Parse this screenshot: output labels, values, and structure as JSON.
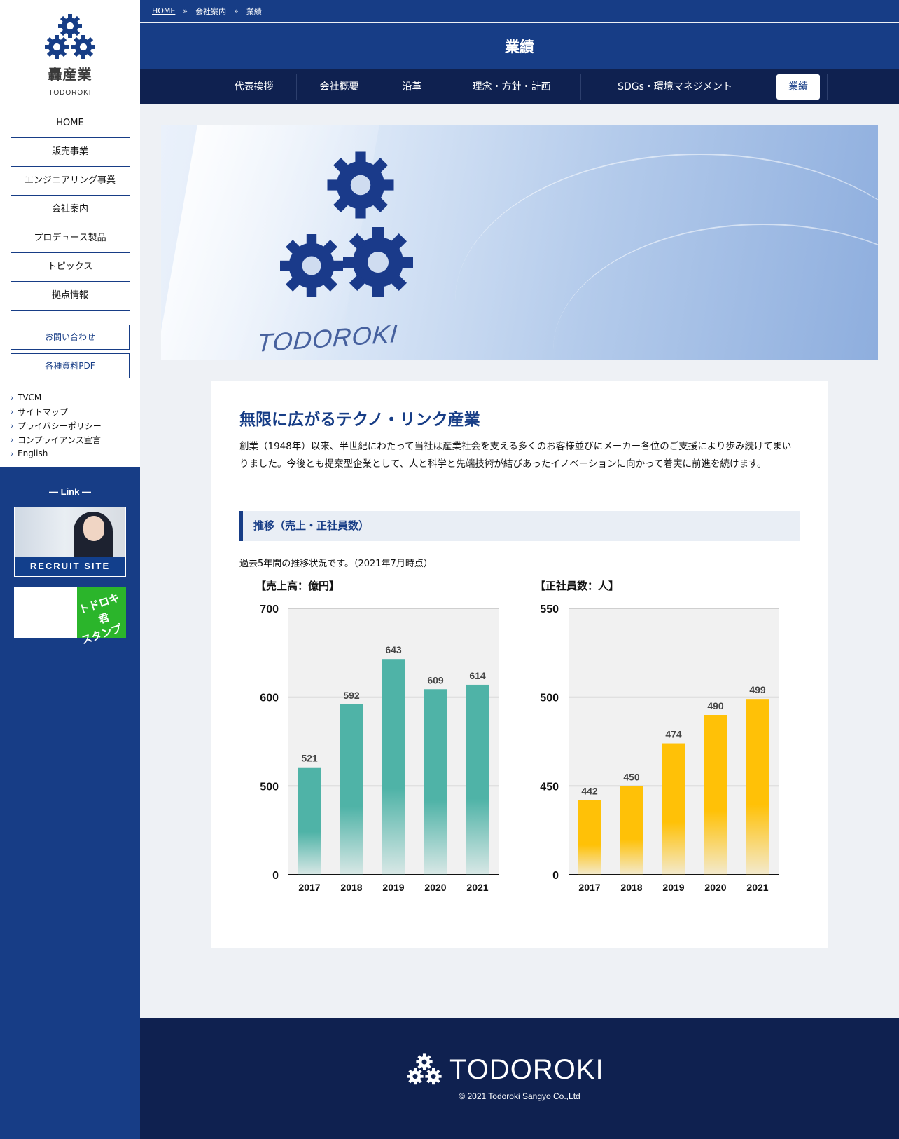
{
  "sidebar": {
    "logo_jp": "轟産業",
    "logo_en": "TODOROKI",
    "nav": [
      "HOME",
      "販売事業",
      "エンジニアリング事業",
      "会社案内",
      "プロデュース製品",
      "トピックス",
      "拠点情報"
    ],
    "contact_label": "お問い合わせ",
    "pdf_label": "各種資料PDF",
    "small_links": [
      "TVCM",
      "サイトマップ",
      "プライバシーポリシー",
      "コンプライアンス宣言",
      "English"
    ],
    "link_title": "— Link —",
    "recruit_label": "RECRUIT SITE",
    "stamp_text_1": "トドロキ君",
    "stamp_text_2": "スタンプ"
  },
  "breadcrumb": {
    "home": "HOME",
    "company": "会社案内",
    "current": "業績",
    "separator": "»"
  },
  "header": {
    "title": "業績",
    "tabs": [
      "代表挨拶",
      "会社概要",
      "沿革",
      "理念・方針・計画",
      "SDGs・環境マネジメント",
      "業績"
    ],
    "active_tab": "業績"
  },
  "hero": {
    "brand": "TODOROKI"
  },
  "content": {
    "catch": "無限に広がるテクノ・リンク産業",
    "intro": "創業（1948年）以来、半世紀にわたって当社は産業社会を支える多くのお客様並びにメーカー各位のご支援により歩み続けてまいりました。今後とも提案型企業として、人と科学と先端技術が結びあったイノベーションに向かって着実に前進を続けます。",
    "section_title": "推移（売上・正社員数）",
    "note": "過去5年間の推移状況です。（2021年7月時点）"
  },
  "chart_data": [
    {
      "type": "bar",
      "title": "【売上高：億円】",
      "categories": [
        "2017",
        "2018",
        "2019",
        "2020",
        "2021"
      ],
      "values": [
        521,
        592,
        643,
        609,
        614
      ],
      "axis_ticks": [
        0,
        500,
        600,
        700
      ],
      "ylim": [
        400,
        700
      ],
      "axis_break": true,
      "grid": true,
      "color": "#4fb3a7"
    },
    {
      "type": "bar",
      "title": "【正社員数：人】",
      "categories": [
        "2017",
        "2018",
        "2019",
        "2020",
        "2021"
      ],
      "values": [
        442,
        450,
        474,
        490,
        499
      ],
      "axis_ticks": [
        0,
        450,
        500,
        550
      ],
      "ylim": [
        400,
        550
      ],
      "axis_break": true,
      "grid": true,
      "color": "#ffc107"
    }
  ],
  "footer": {
    "brand": "TODOROKI",
    "copyright": "© 2021 Todoroki Sangyo Co.,Ltd"
  },
  "colors": {
    "primary": "#173d86",
    "dark": "#0f2150",
    "teal": "#4fb3a7",
    "yellow": "#ffc107"
  }
}
